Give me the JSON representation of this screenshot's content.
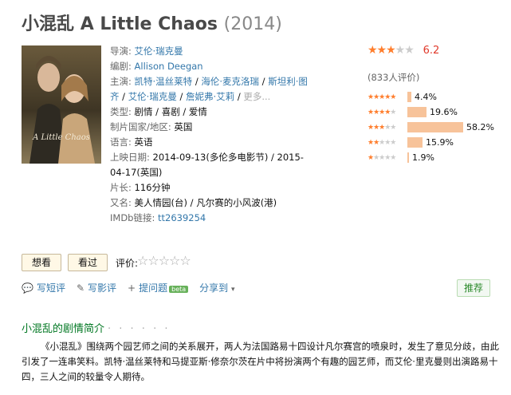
{
  "header": {
    "title_cn": "小混乱",
    "title_en": "A Little Chaos",
    "year": "(2014)"
  },
  "info": {
    "director_label": "导演:",
    "director": "艾伦·瑞克曼",
    "writer_label": "编剧:",
    "writer": "Allison Deegan",
    "cast_label": "主演:",
    "cast": [
      "凯特·温丝莱特",
      "海伦·麦克洛瑞",
      "斯坦利·图齐",
      "艾伦·瑞克曼",
      "詹妮弗·艾莉"
    ],
    "cast_more": "更多...",
    "genre_label": "类型:",
    "genres": [
      "剧情",
      "喜剧",
      "爱情"
    ],
    "country_label": "制片国家/地区:",
    "country": "英国",
    "language_label": "语言:",
    "language": "英语",
    "release_label": "上映日期:",
    "release": "2014-09-13(多伦多电影节) / 2015-04-17(英国)",
    "runtime_label": "片长:",
    "runtime": "116分钟",
    "aka_label": "又名:",
    "aka": "美人情园(台) / 凡尔赛的小风波(港)",
    "imdb_label": "IMDb链接:",
    "imdb": "tt2639254"
  },
  "rating": {
    "score": "6.2",
    "star_level": 3.0,
    "votes": "(833人评价)",
    "breakdown": [
      {
        "stars": 5,
        "percent": 4.4,
        "label": "4.4%"
      },
      {
        "stars": 4,
        "percent": 19.6,
        "label": "19.6%"
      },
      {
        "stars": 3,
        "percent": 58.2,
        "label": "58.2%"
      },
      {
        "stars": 2,
        "percent": 15.9,
        "label": "15.9%"
      },
      {
        "stars": 1,
        "percent": 1.9,
        "label": "1.9%"
      }
    ]
  },
  "interest": {
    "want": "想看",
    "seen": "看过",
    "rate_label": "评价:"
  },
  "actions": {
    "short_review": "写短评",
    "review": "写影评",
    "question": "提问题",
    "beta": "beta",
    "share": "分享到",
    "recommend": "推荐"
  },
  "summary": {
    "title": "小混乱的剧情简介",
    "dots": "· · · · · ·",
    "text": "《小混乱》围绕两个园艺师之间的关系展开，两人为法国路易十四设计凡尔赛宫的喷泉时，发生了意见分歧，由此引发了一连串笑料。凯特·温丝莱特和马提亚斯·修奈尔茨在片中将扮演两个有趣的园艺师，而艾伦·里克曼则出演路易十四，三人之间的较量令人期待。"
  },
  "poster": {
    "caption": "A Little Chaos"
  },
  "colors": {
    "accent": "#ff7e2d",
    "link": "#3377aa",
    "bar": "#f7c39a",
    "section": "#007722"
  }
}
